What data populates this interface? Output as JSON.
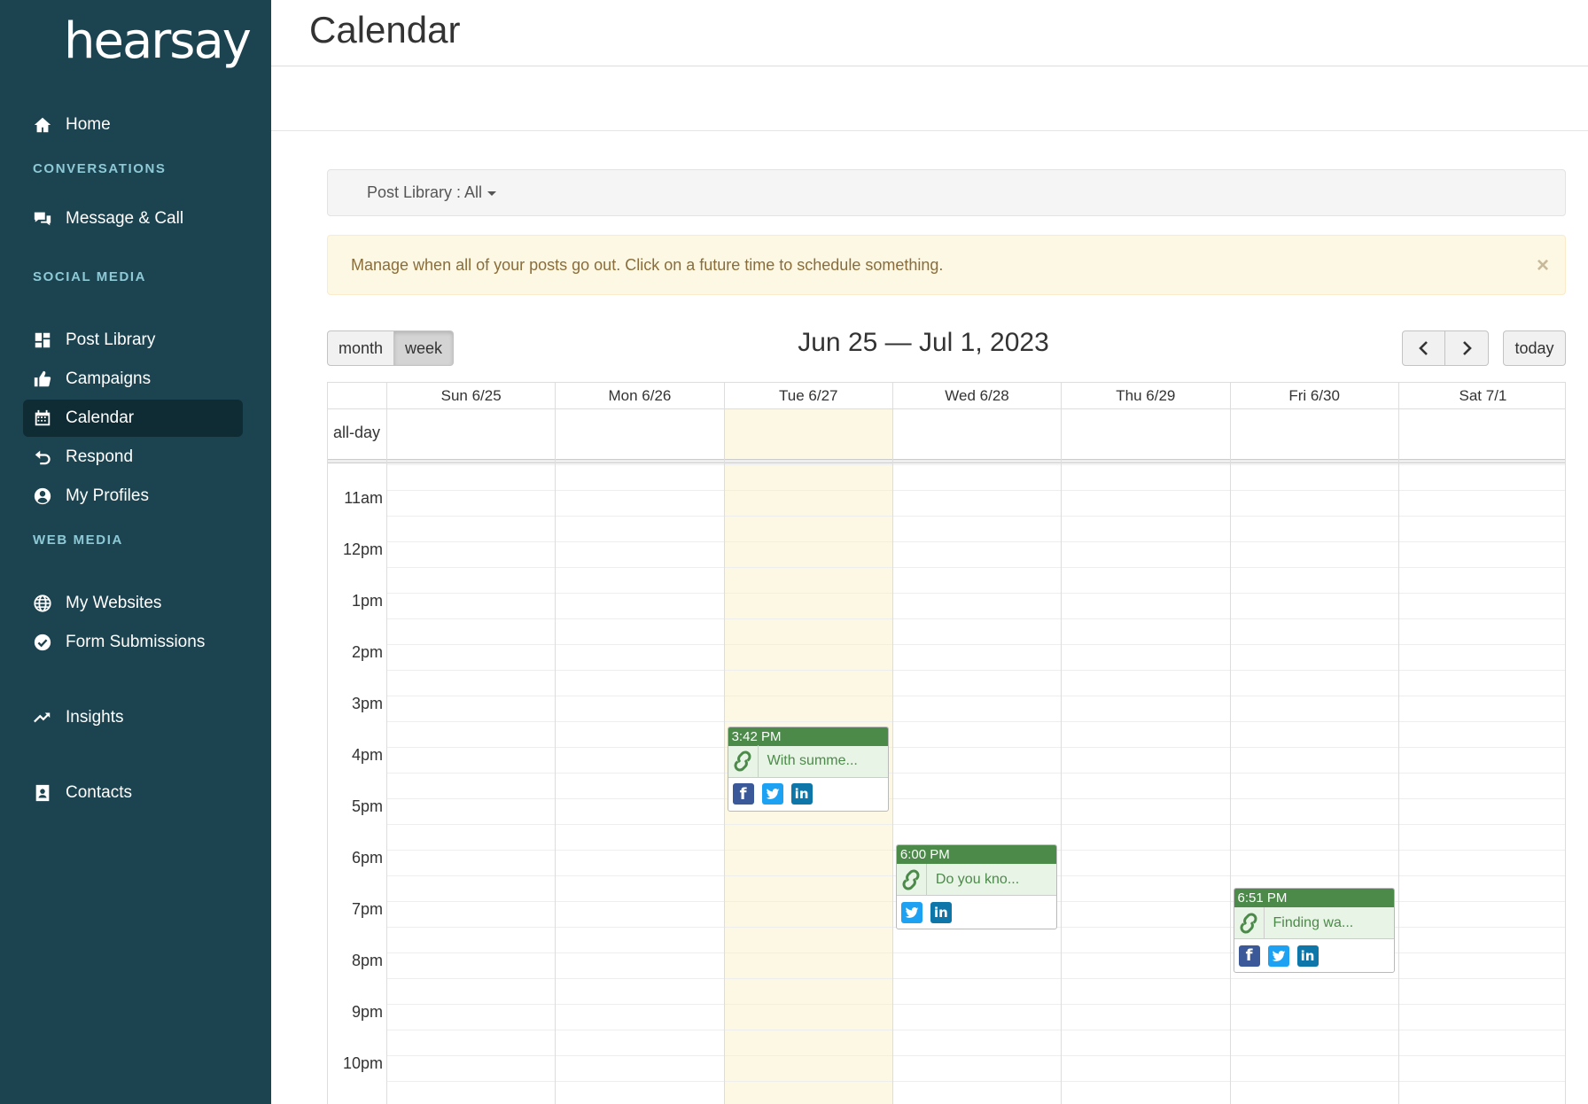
{
  "sidebar": {
    "logo": "hearsay",
    "home": "Home",
    "sections": {
      "conversations": "CONVERSATIONS",
      "social_media": "SOCIAL MEDIA",
      "web_media": "WEB MEDIA"
    },
    "items": {
      "message_call": "Message & Call",
      "post_library": "Post Library",
      "campaigns": "Campaigns",
      "calendar": "Calendar",
      "respond": "Respond",
      "my_profiles": "My Profiles",
      "my_websites": "My Websites",
      "form_submissions": "Form Submissions",
      "insights": "Insights",
      "contacts": "Contacts"
    },
    "active": "Calendar"
  },
  "main": {
    "title": "Calendar",
    "filter": "Post Library : All",
    "alert": "Manage when all of your posts go out. Click on a future time to schedule something.",
    "alert_close": "×",
    "view_buttons": {
      "month": "month",
      "week": "week"
    },
    "active_view": "week",
    "range": "Jun 25 — Jul 1, 2023",
    "today_button": "today"
  },
  "calendar": {
    "days": [
      "Sun 6/25",
      "Mon 6/26",
      "Tue 6/27",
      "Wed 6/28",
      "Thu 6/29",
      "Fri 6/30",
      "Sat 7/1"
    ],
    "today_day": "Tue 6/27",
    "all_day_label": "all-day",
    "times": [
      "11am",
      "12pm",
      "1pm",
      "2pm",
      "3pm",
      "4pm",
      "5pm",
      "6pm",
      "7pm",
      "8pm",
      "9pm",
      "10pm"
    ],
    "events": [
      {
        "day": "Tue 6/27",
        "time": "3:42 PM",
        "text": "With summe...",
        "networks": [
          "facebook",
          "twitter",
          "linkedin"
        ]
      },
      {
        "day": "Wed 6/28",
        "time": "6:00 PM",
        "text": "Do you kno...",
        "networks": [
          "twitter",
          "linkedin"
        ]
      },
      {
        "day": "Fri 6/30",
        "time": "6:51 PM",
        "text": "Finding wa...",
        "networks": [
          "facebook",
          "twitter",
          "linkedin"
        ]
      }
    ]
  },
  "colors": {
    "sidebar_bg": "#1c4350",
    "sidebar_active": "#0f2b33",
    "section_header": "#8ec9d6",
    "event_header": "#4c8a4a",
    "today_highlight": "#fcf8e3"
  }
}
